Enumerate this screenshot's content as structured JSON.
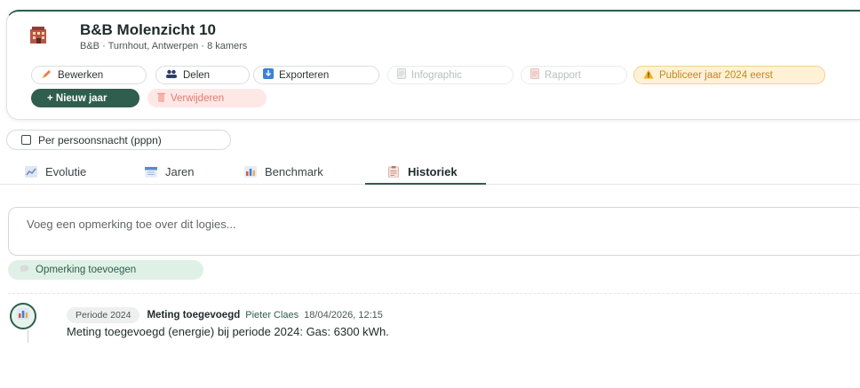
{
  "property": {
    "icon": "hotel-building-icon",
    "title": "B&B Molenzicht 10",
    "subtitle": "B&B · Turnhout, Antwerpen · 8 kamers"
  },
  "actions": {
    "edit": {
      "label": "Bewerken",
      "icon": "pencil-icon"
    },
    "share": {
      "label": "Delen",
      "icon": "people-icon"
    },
    "export": {
      "label": "Exporteren",
      "icon": "download-icon"
    },
    "infographic": {
      "label": "Infographic",
      "icon": "document-icon"
    },
    "report": {
      "label": "Rapport",
      "icon": "report-icon"
    },
    "publish_warning": {
      "label": "Publiceer jaar 2024 eerst",
      "icon": "warning-icon"
    },
    "new_year": {
      "label": "+ Nieuw jaar"
    },
    "delete": {
      "label": "Verwijderen",
      "icon": "trash-icon"
    }
  },
  "pppn_toggle": {
    "label": "Per persoonsnacht (pppn)",
    "checked": false
  },
  "tabs": [
    {
      "label": "Evolutie",
      "icon": "line-chart-icon",
      "active": false
    },
    {
      "label": "Jaren",
      "icon": "calendar-icon",
      "active": false
    },
    {
      "label": "Benchmark",
      "icon": "bar-chart-icon",
      "active": false
    },
    {
      "label": "Historiek",
      "icon": "clipboard-icon",
      "active": true
    }
  ],
  "comment": {
    "placeholder": "Voeg een opmerking toe over dit logies...",
    "add_label": "Opmerking toevoegen"
  },
  "history": [
    {
      "icon": "bar-chart-icon",
      "period": "Periode 2024",
      "type": "Meting toegevoegd",
      "user": "Pieter Claes",
      "date": "18/04/2026, 12:15",
      "text": "Meting toegevoegd (energie) bij periode 2024: Gas: 6300 kWh."
    }
  ],
  "colors": {
    "accent": "#2f5d4e",
    "warning_bg": "#fff1d6",
    "danger_bg": "#fde8e6",
    "success_bg": "#dff1e6"
  }
}
